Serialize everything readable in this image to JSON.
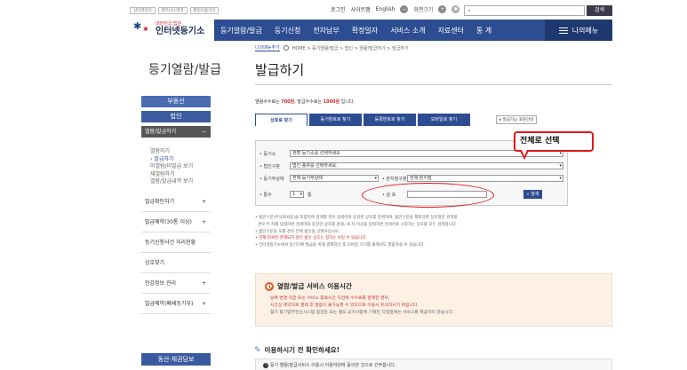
{
  "util": {
    "links": [
      "신다역하기",
      "파트너스영역",
      "편리이용가기"
    ],
    "login": "로그인",
    "sitemap": "사이트맵",
    "english": "English",
    "zoom_label": "화면크기",
    "search_button": "검색"
  },
  "logo": {
    "top": "대한민국 법원",
    "main": "인터넷등기소"
  },
  "nav": {
    "items": [
      "등기열람/발급",
      "등기신청",
      "전자납부",
      "확정일자",
      "서비스 소개",
      "자료센터",
      "통 계"
    ],
    "mymenu": "나의메뉴"
  },
  "breadcrumb": {
    "help": "나의메뉴추가",
    "path": "HOME > 등기열람/발급 > 법인 > 열람/발급하기 > 발급하기"
  },
  "sidebar": {
    "title": "등기열람/발급",
    "realestate": "부동산",
    "corporation": "법인",
    "selected": "열람/발급하기",
    "subs": [
      "열람하기",
      "발급하기",
      "미열람/미발급 보기",
      "재열람하기",
      "열람/발급내역 보기"
    ],
    "rows": [
      {
        "label": "발급확인하기",
        "plus": true
      },
      {
        "label": "발급예약(30통 이상)",
        "plus": true
      },
      {
        "label": "등기신청사건 처리현황",
        "plus": false
      },
      {
        "label": "상호찾기",
        "plus": false
      },
      {
        "label": "인감정보 관리",
        "plus": true
      },
      {
        "label": "발급예약(폐쇄등기부)",
        "plus": true
      }
    ],
    "bottom": "동산·채권담보"
  },
  "main": {
    "title": "발급하기",
    "count_prefix": "열람수수료는",
    "count_fee1": "700원",
    "count_mid": ", 발급수수료는",
    "count_fee2": "1000원",
    "count_suffix": "입니다.",
    "tabs": [
      "상호로 찾기",
      "등기번호로 찾기",
      "등록번호로 찾기",
      "모바일로 찾기"
    ],
    "help_link": "발급가능 표준안내"
  },
  "form": {
    "office_label": "등기소",
    "office_value": "관할 등기소를 선택하세요.",
    "type_label": "법인구분",
    "type_value": "법인 종류를 선택하세요.",
    "status_label": "등기부상태",
    "status_value": "전체 등기부상태",
    "branch_label": "본지점구분",
    "branch_value": "전체 본지점",
    "copies_label": "통수",
    "copies_value": "1",
    "copies_unit": "통",
    "name_label": "상 호",
    "search": "검색"
  },
  "callout": "전체로 선택",
  "notes": [
    {
      "text": "법인구분(주식회사등)을 포함하여 검색할 경우 검색어와 동일한 상호를 검색하며, 법인구분을 제외하면 상호명만 검색할",
      "red": false
    },
    {
      "text": "경우 두 자를 입력하면 검색어와 동일한 상호를 검색, 세 자 이상을 입력하면 검색어로 시작하는 상호를 모두 검색합니다.",
      "red": false
    },
    {
      "text": "법인구분을 모를 경우 전체 법인을 선택하십시오.",
      "red": false
    },
    {
      "text": "현재 회복된 결재되지 않은 법인 상호는 정하는 보일 수 있습니다.",
      "red": true
    },
    {
      "text": "인터넷등기소에서 등기기록 발급을 위해 결제하신 후 모바일 기기를 통해서도 열람하실 수 있습니다.",
      "red": false
    }
  ],
  "service": {
    "title": "열람/발급 서비스 이용시간",
    "lines": [
      "날짜 변경 직전 또는 서비스 종료시간 직전에 수수료를 결제한 경우,",
      "시간상 제약으로 결제 후 열람이 불가능할 수 있으므로 이용시 유의하시기 바랍니다.",
      "첨가 등기업무전산시스템 점검일 또는 별도 공지사항에 기재된 작업일에는 서비스를 제공하지 않습니다."
    ]
  },
  "check": {
    "title": "이용하시기 전 확인하세요!",
    "line": "등기 열람/발급서비스 이용시 이용약관에 동의한 것으로 간주합니다."
  }
}
